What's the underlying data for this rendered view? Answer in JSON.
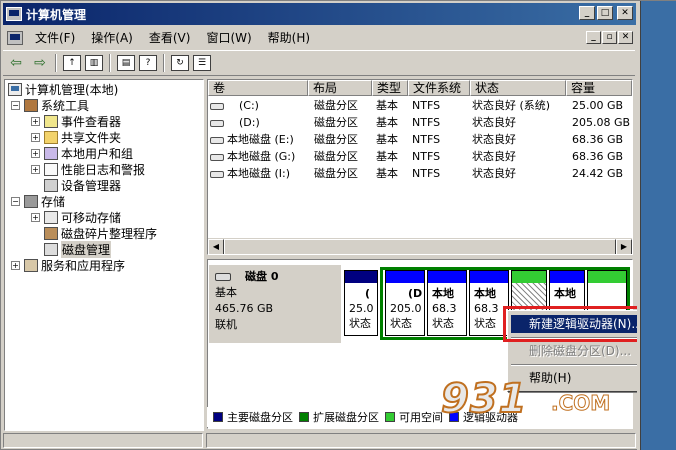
{
  "window": {
    "title": "计算机管理"
  },
  "menubar": {
    "items": [
      "文件(F)",
      "操作(A)",
      "查看(V)",
      "窗口(W)",
      "帮助(H)"
    ]
  },
  "toolbar": {
    "back_icon": "back-arrow-icon",
    "forward_icon": "forward-arrow-icon"
  },
  "tree": {
    "root": "计算机管理(本地)",
    "system_tools": "系统工具",
    "event_viewer": "事件查看器",
    "shared_folders": "共享文件夹",
    "local_users": "本地用户和组",
    "perf_logs": "性能日志和警报",
    "device_manager": "设备管理器",
    "storage": "存储",
    "removable": "可移动存储",
    "defrag": "磁盘碎片整理程序",
    "disk_mgmt": "磁盘管理",
    "services": "服务和应用程序"
  },
  "volume_list": {
    "columns": [
      "卷",
      "布局",
      "类型",
      "文件系统",
      "状态",
      "容量"
    ],
    "rows": [
      {
        "volume": "(C:)",
        "layout": "磁盘分区",
        "type": "基本",
        "fs": "NTFS",
        "status": "状态良好 (系统)",
        "capacity": "25.00 GB"
      },
      {
        "volume": "(D:)",
        "layout": "磁盘分区",
        "type": "基本",
        "fs": "NTFS",
        "status": "状态良好",
        "capacity": "205.08 GB"
      },
      {
        "volume": "本地磁盘 (E:)",
        "layout": "磁盘分区",
        "type": "基本",
        "fs": "NTFS",
        "status": "状态良好",
        "capacity": "68.36 GB"
      },
      {
        "volume": "本地磁盘 (G:)",
        "layout": "磁盘分区",
        "type": "基本",
        "fs": "NTFS",
        "status": "状态良好",
        "capacity": "68.36 GB"
      },
      {
        "volume": "本地磁盘 (I:)",
        "layout": "磁盘分区",
        "type": "基本",
        "fs": "NTFS",
        "status": "状态良好",
        "capacity": "24.42 GB"
      }
    ]
  },
  "disk": {
    "name": "磁盘 0",
    "type": "基本",
    "size": "465.76 GB",
    "state": "联机",
    "partitions": [
      {
        "l1": "(",
        "l2": "25.0",
        "l3": "状态"
      },
      {
        "l1": "(D",
        "l2": "205.0",
        "l3": "状态"
      },
      {
        "l1": "本地",
        "l2": "68.3",
        "l3": "状态"
      },
      {
        "l1": "本地",
        "l2": "68.3",
        "l3": "状态"
      },
      {
        "l1": "",
        "l2": "",
        "l3": ""
      },
      {
        "l1": "本地",
        "l2": "",
        "l3": ""
      },
      {
        "l1": "",
        "l2": "",
        "l3": ""
      }
    ]
  },
  "legend": [
    "主要磁盘分区",
    "扩展磁盘分区",
    "可用空间",
    "逻辑驱动器"
  ],
  "context_menu": {
    "new_logical": "新建逻辑驱动器(N)...",
    "delete_partition": "删除磁盘分区(D)...",
    "help": "帮助(H)"
  },
  "watermark": {
    "text": "931",
    "domain": ".COM"
  },
  "colors": {
    "primary": "#000080",
    "extended": "#008000",
    "free": "#33cc33",
    "logical": "#0000ff"
  }
}
